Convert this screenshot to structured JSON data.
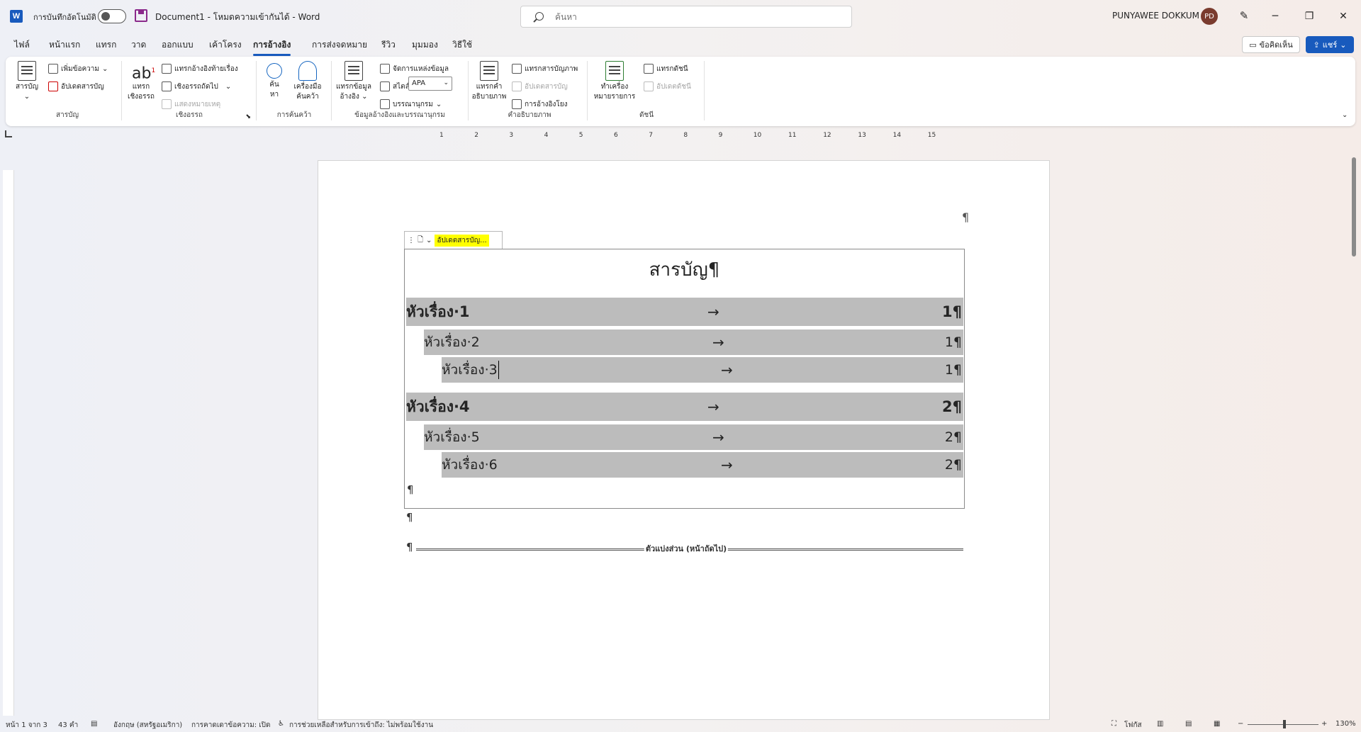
{
  "titlebar": {
    "autosave_label": "การบันทึกอัตโนมัติ",
    "document_title": "Document1 - โหมดความเข้ากันได้ - Word",
    "search_placeholder": "ค้นหา",
    "user_name": "PUNYAWEE DOKKUM",
    "user_initials": "PD",
    "minimize": "─",
    "restore": "❐",
    "close": "✕"
  },
  "tabs": [
    {
      "label": "ไฟล์"
    },
    {
      "label": "หน้าแรก"
    },
    {
      "label": "แทรก"
    },
    {
      "label": "วาด"
    },
    {
      "label": "ออกแบบ"
    },
    {
      "label": "เค้าโครง"
    },
    {
      "label": "การอ้างอิง"
    },
    {
      "label": "การส่งจดหมาย"
    },
    {
      "label": "รีวิว"
    },
    {
      "label": "มุมมอง"
    },
    {
      "label": "วิธีใช้"
    }
  ],
  "actions": {
    "comments": "ข้อคิดเห็น",
    "share": "แชร์"
  },
  "ribbon": {
    "toc_group": {
      "label": "สารบัญ",
      "toc_button": "สารบัญ",
      "add_text": "เพิ่มข้อความ",
      "update_table": "อัปเดตสารบัญ"
    },
    "footnotes_group": {
      "label": "เชิงอรรถ",
      "insert_footnote_line1": "แทรก",
      "insert_footnote_line2": "เชิงอรรถ",
      "insert_endnote": "แทรกอ้างอิงท้ายเรื่อง",
      "next_footnote": "เชิงอรรถถัดไป",
      "show_notes": "แสดงหมายเหตุ"
    },
    "research_group": {
      "label": "การค้นคว้า",
      "search_line1": "ค้น",
      "search_line2": "หา",
      "researcher_line1": "เครื่องมือ",
      "researcher_line2": "ค้นคว้า"
    },
    "citations_group": {
      "label": "ข้อมูลอ้างอิงและบรรณานุกรม",
      "insert_citation_line1": "แทรกข้อมูล",
      "insert_citation_line2": "อ้างอิง",
      "manage_sources": "จัดการแหล่งข้อมูล",
      "style_label": "สไตล์:",
      "style_value": "APA",
      "bibliography": "บรรณานุกรม"
    },
    "captions_group": {
      "label": "คำอธิบายภาพ",
      "insert_caption_line1": "แทรกคำ",
      "insert_caption_line2": "อธิบายภาพ",
      "insert_table_of_figures": "แทรกสารบัญภาพ",
      "update_table": "อัปเดตสารบัญ",
      "cross_reference": "การอ้างอิงโยง"
    },
    "index_group": {
      "label": "ดัชนี",
      "mark_entry_line1": "ทำเครื่อง",
      "mark_entry_line2": "หมายรายการ",
      "insert_index": "แทรกดัชนี",
      "update_index": "อัปเดตดัชนี"
    }
  },
  "ruler": {
    "numbers": [
      "1",
      "2",
      "3",
      "4",
      "5",
      "6",
      "7",
      "8",
      "9",
      "10",
      "11",
      "12",
      "13",
      "14",
      "15"
    ]
  },
  "document": {
    "top_pilcrow": "¶",
    "toc_control_update": "อัปเดตสารบัญ...",
    "toc_title": "สารบัญ¶",
    "entries": [
      {
        "text": "หัวเรื่อง·1",
        "page": "1¶",
        "arrow": "→"
      },
      {
        "text": "หัวเรื่อง·2",
        "page": "1¶",
        "arrow": "→"
      },
      {
        "text": "หัวเรื่อง·3",
        "page": "1¶",
        "arrow": "→"
      },
      {
        "text": "หัวเรื่อง·4",
        "page": "2¶",
        "arrow": "→"
      },
      {
        "text": "หัวเรื่อง·5",
        "page": "2¶",
        "arrow": "→"
      },
      {
        "text": "หัวเรื่อง·6",
        "page": "2¶",
        "arrow": "→"
      }
    ],
    "end_pilcrow_1": "¶",
    "end_pilcrow_2": "¶",
    "section_break_pilcrow": "¶",
    "section_break": "ตัวแบ่งส่วน (หน้าถัดไป)"
  },
  "statusbar": {
    "page": "หน้า 1 จาก 3",
    "words": "43 คำ",
    "language": "อังกฤษ (สหรัฐอเมริกา)",
    "text_prediction": "การคาดเดาข้อความ: เปิด",
    "accessibility": "การช่วยเหลือสำหรับการเข้าถึง: ไม่พร้อมใช้งาน",
    "focus": "โฟกัส",
    "zoom": "130%",
    "zoom_minus": "−",
    "zoom_plus": "+"
  }
}
